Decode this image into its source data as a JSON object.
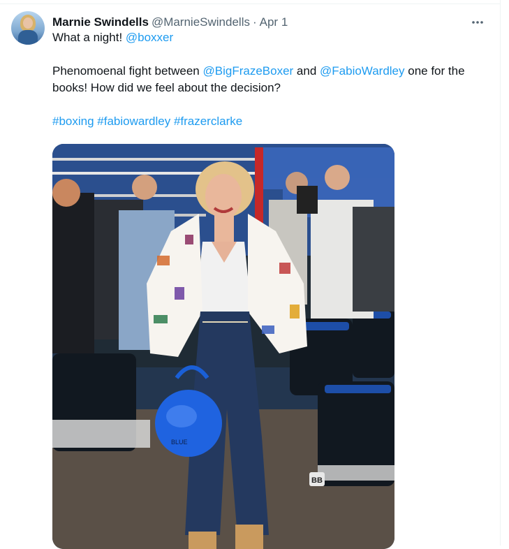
{
  "tweet": {
    "author": {
      "display_name": "Marnie Swindells",
      "handle": "@MarnieSwindells"
    },
    "separator": "·",
    "date": "Apr 1",
    "more_icon": "more-horizontal-icon",
    "body": {
      "line1": {
        "text": "What a night! ",
        "mention": "@boxxer"
      },
      "line2": {
        "text_a": "Phenomoenal fight between ",
        "mention_a": "@BigFrazeBoxer",
        "text_b": " and ",
        "mention_b": "@FabioWardley",
        "text_c": " one for the books! How did we feel about the decision?"
      },
      "hashtags": [
        "#boxing",
        "#fabiowardley",
        "#frazerclarke"
      ]
    },
    "colors": {
      "link": "#1d9bf0",
      "secondary_text": "#536471",
      "primary_text": "#0f1419"
    }
  }
}
